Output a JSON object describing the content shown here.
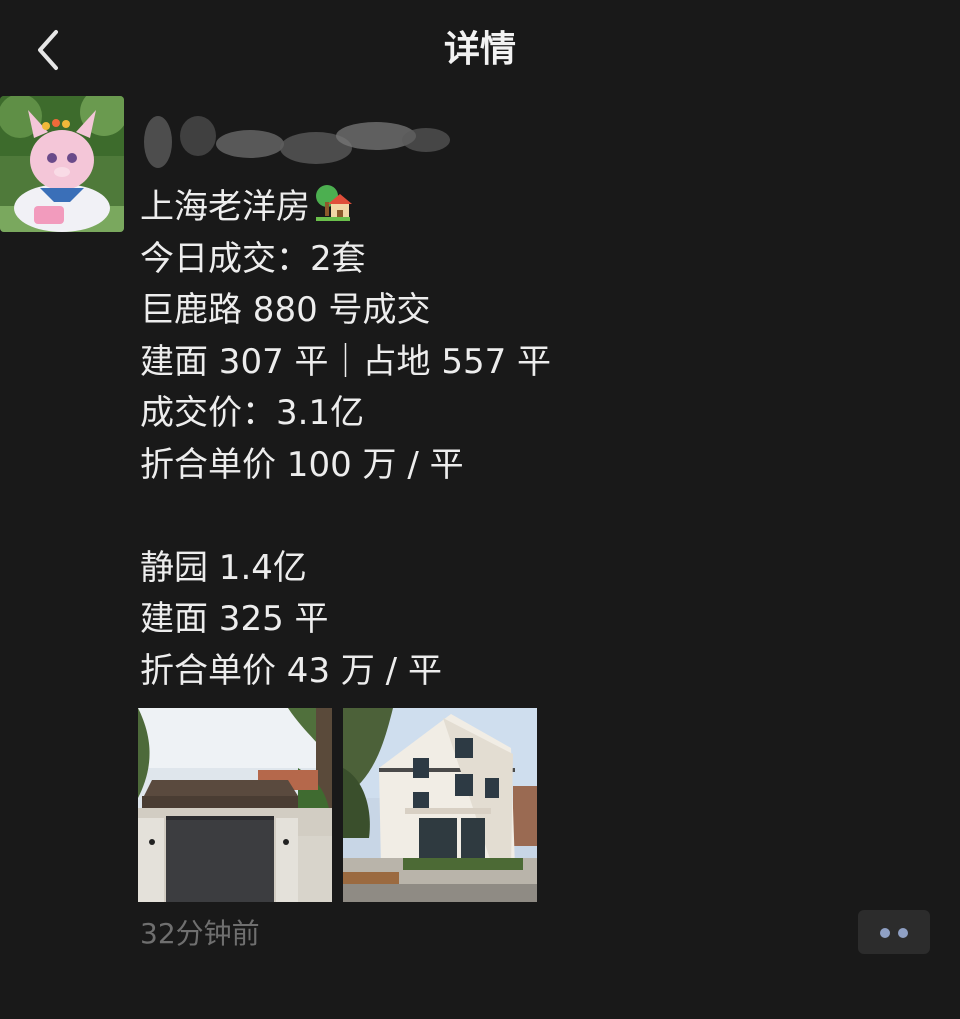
{
  "nav": {
    "title": "详情"
  },
  "post": {
    "lines": [
      "上海老洋房",
      "今日成交：2套",
      "巨鹿路 880 号成交",
      "建面 307 平｜占地 557 平",
      "成交价：3.1亿",
      "折合单价 100 万 / 平",
      "",
      "静园 1.4亿",
      "建面 325 平",
      "折合单价 43 万 / 平"
    ],
    "time": "32分钟前"
  },
  "icons": {
    "back": "back-chevron-icon",
    "title_emoji": "house-with-garden-emoji",
    "more": "more-dots-icon"
  },
  "colors": {
    "background": "#191919",
    "text": "#ededed",
    "timestamp": "#6f6f6f",
    "more_dots": "#8fa0c4"
  }
}
